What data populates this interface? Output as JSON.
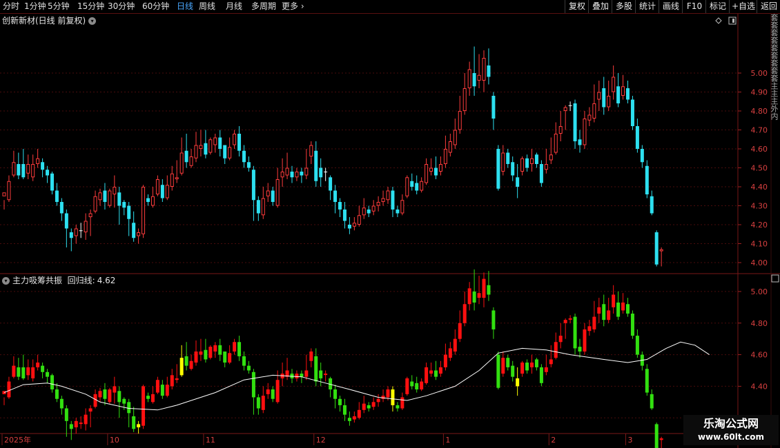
{
  "period_tabs": [
    "分时",
    "1分钟",
    "5分钟",
    "15分钟",
    "30分钟",
    "60分钟",
    "日线",
    "周线",
    "月线",
    "多周期",
    "更多"
  ],
  "active_period": "日线",
  "toolbar": [
    "复权",
    "叠加",
    "多股",
    "统计",
    "画线",
    "F10",
    "标记",
    "+自选",
    "返回"
  ],
  "main_title": "创新新材(日线 前复权)",
  "indicator": {
    "name": "主力吸筹共振",
    "line_name": "回归线:",
    "line_value": "4.62"
  },
  "right_strip_text": "套套套套套套套套套主主主外内",
  "watermark": {
    "line1": "乐淘公式网",
    "line2": "www.60lt.com"
  },
  "chart_data": [
    {
      "type": "candlestick",
      "title": "创新新材(日线 前复权)",
      "ylim": [
        3.96,
        5.24
      ],
      "yticks": [
        5.0,
        4.9,
        4.8,
        4.7,
        4.6,
        4.5,
        4.4,
        4.3,
        4.2,
        4.1,
        4.0
      ],
      "colors": {
        "up": "#ff3c3c",
        "down": "#2de0f0",
        "flat": "#ffffff",
        "grid": "#4a0c0c"
      },
      "candles": [
        [
          4.35,
          4.37,
          4.28,
          4.33
        ],
        [
          4.33,
          4.43,
          4.32,
          4.46
        ],
        [
          4.46,
          4.53,
          4.45,
          4.59
        ],
        [
          4.52,
          4.46,
          4.44,
          4.58
        ],
        [
          4.52,
          4.45,
          4.44,
          4.6
        ],
        [
          4.47,
          4.52,
          4.44,
          4.57
        ],
        [
          4.45,
          4.52,
          4.43,
          4.57
        ],
        [
          4.52,
          4.55,
          4.5,
          4.6
        ],
        [
          4.53,
          4.49,
          4.45,
          4.55
        ],
        [
          4.49,
          4.46,
          4.42,
          4.51
        ],
        [
          4.47,
          4.38,
          4.36,
          4.48
        ],
        [
          4.38,
          4.32,
          4.3,
          4.42
        ],
        [
          4.32,
          4.26,
          4.22,
          4.34
        ],
        [
          4.26,
          4.18,
          4.08,
          4.28
        ],
        [
          4.16,
          4.13,
          4.06,
          4.18
        ],
        [
          4.14,
          4.18,
          4.1,
          4.2
        ],
        [
          4.17,
          4.17,
          4.13,
          4.21
        ],
        [
          4.16,
          4.22,
          4.12,
          4.26
        ],
        [
          4.24,
          4.26,
          4.14,
          4.28
        ],
        [
          4.27,
          4.35,
          4.26,
          4.38
        ],
        [
          4.33,
          4.37,
          4.3,
          4.39
        ],
        [
          4.38,
          4.32,
          4.28,
          4.42
        ],
        [
          4.3,
          4.38,
          4.29,
          4.39
        ],
        [
          4.36,
          4.4,
          4.29,
          4.46
        ],
        [
          4.37,
          4.3,
          4.2,
          4.4
        ],
        [
          4.32,
          4.29,
          4.25,
          4.33
        ],
        [
          4.3,
          4.23,
          4.14,
          4.32
        ],
        [
          4.21,
          4.13,
          4.11,
          4.27
        ],
        [
          4.14,
          4.16,
          4.1,
          4.18
        ],
        [
          4.15,
          4.4,
          4.13,
          4.41
        ],
        [
          4.34,
          4.32,
          4.3,
          4.36
        ],
        [
          4.3,
          4.35,
          4.29,
          4.4
        ],
        [
          4.36,
          4.44,
          4.35,
          4.46
        ],
        [
          4.41,
          4.34,
          4.32,
          4.44
        ],
        [
          4.34,
          4.41,
          4.33,
          4.46
        ],
        [
          4.4,
          4.47,
          4.38,
          4.51
        ],
        [
          4.44,
          4.45,
          4.42,
          4.54
        ],
        [
          4.47,
          4.58,
          4.46,
          4.66
        ],
        [
          4.59,
          4.53,
          4.5,
          4.68
        ],
        [
          4.51,
          4.56,
          4.5,
          4.6
        ],
        [
          4.55,
          4.62,
          4.53,
          4.69
        ],
        [
          4.6,
          4.62,
          4.56,
          4.7
        ],
        [
          4.63,
          4.57,
          4.55,
          4.7
        ],
        [
          4.58,
          4.65,
          4.57,
          4.66
        ],
        [
          4.62,
          4.66,
          4.58,
          4.68
        ],
        [
          4.66,
          4.6,
          4.56,
          4.7
        ],
        [
          4.62,
          4.55,
          4.52,
          4.62
        ],
        [
          4.55,
          4.61,
          4.54,
          4.66
        ],
        [
          4.62,
          4.68,
          4.6,
          4.7
        ],
        [
          4.68,
          4.59,
          4.56,
          4.72
        ],
        [
          4.59,
          4.53,
          4.5,
          4.62
        ],
        [
          4.53,
          4.5,
          4.48,
          4.56
        ],
        [
          4.49,
          4.33,
          4.22,
          4.51
        ],
        [
          4.33,
          4.26,
          4.22,
          4.35
        ],
        [
          4.25,
          4.34,
          4.23,
          4.4
        ],
        [
          4.35,
          4.38,
          4.32,
          4.42
        ],
        [
          4.38,
          4.32,
          4.3,
          4.4
        ],
        [
          4.3,
          4.44,
          4.29,
          4.5
        ],
        [
          4.45,
          4.48,
          4.4,
          4.55
        ],
        [
          4.46,
          4.5,
          4.44,
          4.58
        ],
        [
          4.48,
          4.45,
          4.42,
          4.51
        ],
        [
          4.45,
          4.48,
          4.43,
          4.5
        ],
        [
          4.48,
          4.46,
          4.42,
          4.5
        ],
        [
          4.46,
          4.5,
          4.44,
          4.6
        ],
        [
          4.56,
          4.62,
          4.52,
          4.64
        ],
        [
          4.59,
          4.43,
          4.4,
          4.64
        ],
        [
          4.5,
          4.45,
          4.4,
          4.55
        ],
        [
          4.48,
          4.48,
          4.43,
          4.5
        ],
        [
          4.45,
          4.38,
          4.33,
          4.46
        ],
        [
          4.38,
          4.32,
          4.26,
          4.41
        ],
        [
          4.32,
          4.28,
          4.24,
          4.34
        ],
        [
          4.28,
          4.22,
          4.18,
          4.32
        ],
        [
          4.2,
          4.18,
          4.15,
          4.24
        ],
        [
          4.19,
          4.21,
          4.17,
          4.24
        ],
        [
          4.2,
          4.25,
          4.19,
          4.3
        ],
        [
          4.25,
          4.29,
          4.23,
          4.34
        ],
        [
          4.28,
          4.26,
          4.24,
          4.3
        ],
        [
          4.27,
          4.3,
          4.25,
          4.33
        ],
        [
          4.3,
          4.32,
          4.27,
          4.35
        ],
        [
          4.32,
          4.34,
          4.3,
          4.38
        ],
        [
          4.33,
          4.38,
          4.31,
          4.4
        ],
        [
          4.38,
          4.28,
          4.24,
          4.4
        ],
        [
          4.28,
          4.26,
          4.24,
          4.3
        ],
        [
          4.26,
          4.33,
          4.25,
          4.36
        ],
        [
          4.35,
          4.45,
          4.34,
          4.46
        ],
        [
          4.43,
          4.4,
          4.38,
          4.47
        ],
        [
          4.42,
          4.38,
          4.36,
          4.46
        ],
        [
          4.38,
          4.43,
          4.37,
          4.45
        ],
        [
          4.42,
          4.52,
          4.41,
          4.55
        ],
        [
          4.48,
          4.5,
          4.46,
          4.55
        ],
        [
          4.5,
          4.46,
          4.44,
          4.56
        ],
        [
          4.48,
          4.52,
          4.46,
          4.56
        ],
        [
          4.52,
          4.6,
          4.5,
          4.67
        ],
        [
          4.58,
          4.64,
          4.56,
          4.68
        ],
        [
          4.62,
          4.7,
          4.6,
          4.76
        ],
        [
          4.7,
          4.8,
          4.68,
          4.88
        ],
        [
          4.8,
          4.92,
          4.78,
          5.0
        ],
        [
          4.92,
          5.02,
          4.88,
          5.06
        ],
        [
          5.0,
          4.93,
          4.88,
          5.14
        ],
        [
          4.96,
          4.99,
          4.92,
          5.1
        ],
        [
          4.96,
          5.08,
          4.9,
          5.12
        ],
        [
          5.04,
          4.98,
          4.94,
          5.13
        ],
        [
          4.88,
          4.76,
          4.7,
          4.9
        ],
        [
          4.6,
          4.39,
          4.38,
          4.62
        ],
        [
          4.48,
          4.58,
          4.46,
          4.62
        ],
        [
          4.58,
          4.52,
          4.5,
          4.6
        ],
        [
          4.53,
          4.46,
          4.43,
          4.56
        ],
        [
          4.45,
          4.4,
          4.34,
          4.52
        ],
        [
          4.48,
          4.55,
          4.46,
          4.56
        ],
        [
          4.55,
          4.5,
          4.48,
          4.57
        ],
        [
          4.52,
          4.55,
          4.48,
          4.6
        ],
        [
          4.57,
          4.52,
          4.5,
          4.58
        ],
        [
          4.52,
          4.42,
          4.4,
          4.54
        ],
        [
          4.49,
          4.52,
          4.47,
          4.6
        ],
        [
          4.54,
          4.57,
          4.52,
          4.66
        ],
        [
          4.58,
          4.68,
          4.57,
          4.74
        ],
        [
          4.68,
          4.72,
          4.64,
          4.8
        ],
        [
          4.8,
          4.82,
          4.7,
          4.83
        ],
        [
          4.83,
          4.83,
          4.8,
          4.85
        ],
        [
          4.84,
          4.64,
          4.6,
          4.86
        ],
        [
          4.65,
          4.62,
          4.58,
          4.7
        ],
        [
          4.62,
          4.76,
          4.6,
          4.8
        ],
        [
          4.75,
          4.78,
          4.72,
          4.82
        ],
        [
          4.76,
          4.84,
          4.74,
          4.94
        ],
        [
          4.86,
          4.9,
          4.8,
          4.96
        ],
        [
          4.92,
          4.82,
          4.78,
          4.98
        ],
        [
          4.82,
          4.88,
          4.8,
          4.96
        ],
        [
          4.9,
          4.98,
          4.86,
          5.04
        ],
        [
          4.93,
          4.84,
          4.82,
          5.0
        ],
        [
          4.88,
          4.93,
          4.86,
          4.99
        ],
        [
          4.92,
          4.86,
          4.84,
          4.96
        ],
        [
          4.86,
          4.72,
          4.7,
          4.88
        ],
        [
          4.72,
          4.6,
          4.58,
          4.76
        ],
        [
          4.6,
          4.53,
          4.5,
          4.62
        ],
        [
          4.51,
          4.36,
          4.34,
          4.54
        ],
        [
          4.35,
          4.26,
          4.25,
          4.38
        ],
        [
          4.16,
          3.99,
          3.98,
          4.17
        ],
        [
          4.06,
          4.07,
          3.98,
          4.08
        ]
      ],
      "x_labels": [
        "2025年",
        "10",
        "11",
        "12",
        "1",
        "2",
        "3"
      ]
    },
    {
      "type": "candlestick",
      "title": "主力吸筹共振",
      "series": [
        {
          "name": "回归线",
          "last_value": 4.62
        }
      ],
      "ylim": [
        4.14,
        5.1
      ],
      "yticks": [
        5.0,
        4.8,
        4.6,
        4.4,
        4.2
      ],
      "colors": {
        "up": "#ff1010",
        "down": "#32e010",
        "signal": "#ffff00",
        "regression": "#ffffff"
      },
      "signal_bars": [
        28,
        37,
        81,
        107,
        147,
        155
      ],
      "regression": [
        [
          0,
          4.36
        ],
        [
          4,
          4.41
        ],
        [
          9,
          4.42
        ],
        [
          12,
          4.4
        ],
        [
          17,
          4.35
        ],
        [
          20,
          4.3
        ],
        [
          26,
          4.26
        ],
        [
          32,
          4.25
        ],
        [
          36,
          4.28
        ],
        [
          44,
          4.36
        ],
        [
          50,
          4.44
        ],
        [
          56,
          4.47
        ],
        [
          62,
          4.46
        ],
        [
          67,
          4.42
        ],
        [
          72,
          4.38
        ],
        [
          78,
          4.33
        ],
        [
          84,
          4.31
        ],
        [
          88,
          4.34
        ],
        [
          94,
          4.4
        ],
        [
          99,
          4.5
        ],
        [
          103,
          4.61
        ],
        [
          108,
          4.64
        ],
        [
          113,
          4.63
        ],
        [
          118,
          4.6
        ],
        [
          125,
          4.57
        ],
        [
          130,
          4.55
        ],
        [
          134,
          4.57
        ],
        [
          138,
          4.64
        ],
        [
          141,
          4.68
        ],
        [
          144,
          4.66
        ],
        [
          147,
          4.6
        ]
      ]
    }
  ]
}
